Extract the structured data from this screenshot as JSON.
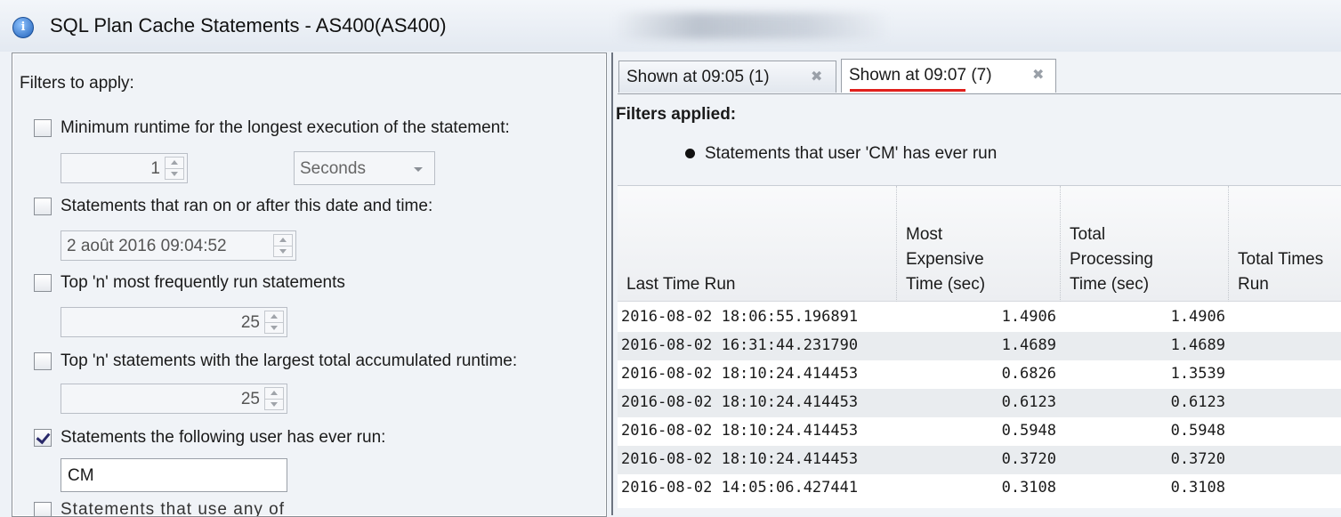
{
  "window": {
    "title": "SQL Plan Cache Statements - AS400(AS400)"
  },
  "filters_panel": {
    "heading": "Filters to apply:",
    "min_runtime": {
      "label": "Minimum runtime for the longest execution of the statement:",
      "checked": false,
      "value": "1",
      "unit": "Seconds"
    },
    "ran_after": {
      "label": "Statements that ran on or after this date and time:",
      "checked": false,
      "value": "2 août 2016 09:04:52"
    },
    "top_frequent": {
      "label": "Top 'n' most frequently run statements",
      "checked": false,
      "value": "25"
    },
    "top_runtime": {
      "label": "Top 'n' statements with the largest total accumulated runtime:",
      "checked": false,
      "value": "25"
    },
    "user_ran": {
      "label": "Statements the following user has ever run:",
      "checked": true,
      "value": "CM"
    },
    "cut_label": "Statements that use any of these"
  },
  "tabs": [
    {
      "label": "Shown at 09:05 (1)",
      "active": false
    },
    {
      "label": "Shown at 09:07 (7)",
      "active": true
    }
  ],
  "filters_applied": {
    "heading": "Filters applied:",
    "items": [
      "Statements that user 'CM' has ever run"
    ]
  },
  "table": {
    "columns": [
      "Last Time Run",
      "Most\nExpensive\nTime (sec)",
      "Total\nProcessing\nTime (sec)",
      "Total Times\nRun"
    ],
    "rows": [
      [
        "2016-08-02 18:06:55.196891",
        "1.4906",
        "1.4906"
      ],
      [
        "2016-08-02 16:31:44.231790",
        "1.4689",
        "1.4689"
      ],
      [
        "2016-08-02 18:10:24.414453",
        "0.6826",
        "1.3539"
      ],
      [
        "2016-08-02 18:10:24.414453",
        "0.6123",
        "0.6123"
      ],
      [
        "2016-08-02 18:10:24.414453",
        "0.5948",
        "0.5948"
      ],
      [
        "2016-08-02 18:10:24.414453",
        "0.3720",
        "0.3720"
      ],
      [
        "2016-08-02 14:05:06.427441",
        "0.3108",
        "0.3108"
      ]
    ]
  },
  "colors": {
    "active_tab_underline": "#e0201c"
  }
}
